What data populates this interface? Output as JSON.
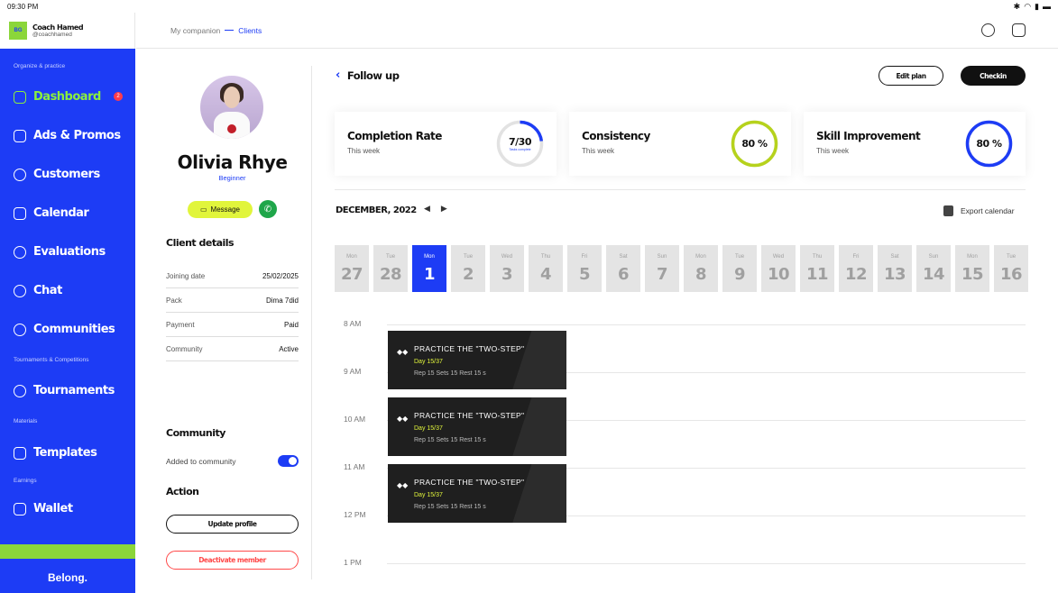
{
  "status": {
    "time": "09:30 PM"
  },
  "brand": {
    "initials": "BG",
    "name": "Coach Hamed",
    "handle": "@coachhamed",
    "footer": "Belong."
  },
  "sidebar": {
    "section_practice": "Organize & practice",
    "section_tournaments": "Tournaments & Competitions",
    "section_materials": "Materials",
    "section_earnings": "Earnings",
    "items": [
      {
        "label": "Dashboard",
        "badge": "2"
      },
      {
        "label": "Ads & Promos"
      },
      {
        "label": "Customers"
      },
      {
        "label": "Calendar"
      },
      {
        "label": "Evaluations"
      },
      {
        "label": "Chat"
      },
      {
        "label": "Communities"
      },
      {
        "label": "Tournaments"
      },
      {
        "label": "Templates"
      },
      {
        "label": "Wallet"
      }
    ]
  },
  "breadcrumb": {
    "parent": "My companion",
    "current": "Clients"
  },
  "profile": {
    "name": "Olivia Rhye",
    "level": "Beginner",
    "message_label": "Message",
    "details_title": "Client details",
    "details": [
      {
        "label": "Joining date",
        "value": "25/02/2025"
      },
      {
        "label": "Pack",
        "value": "Dima 7did"
      },
      {
        "label": "Payment",
        "value": "Paid"
      },
      {
        "label": "Community",
        "value": "Active"
      }
    ],
    "community_title": "Community",
    "community_toggle_label": "Added to community",
    "action_title": "Action",
    "update_label": "Update profile",
    "deactivate_label": "Deactivate member"
  },
  "followup": {
    "title": "Follow up",
    "edit_label": "Edit plan",
    "checkin_label": "Checkin",
    "cards": [
      {
        "title": "Completion Rate",
        "subtitle": "This week",
        "value": "7/30",
        "sub_value": "Tasks complete",
        "progress": 0.23,
        "color": "#1d3cf5"
      },
      {
        "title": "Consistency",
        "subtitle": "This week",
        "value": "80 %",
        "progress": 1.0,
        "color": "#b6d21c"
      },
      {
        "title": "Skill Improvement",
        "subtitle": "This week",
        "value": "80 %",
        "progress": 1.0,
        "color": "#1d3cf5"
      }
    ]
  },
  "calendar": {
    "month": "DECEMBER, 2022",
    "export_label": "Export calendar",
    "days": [
      {
        "name": "Mon",
        "num": "27"
      },
      {
        "name": "Tue",
        "num": "28"
      },
      {
        "name": "Mon",
        "num": "1",
        "selected": true
      },
      {
        "name": "Tue",
        "num": "2"
      },
      {
        "name": "Wed",
        "num": "3"
      },
      {
        "name": "Thu",
        "num": "4"
      },
      {
        "name": "Fri",
        "num": "5"
      },
      {
        "name": "Sat",
        "num": "6"
      },
      {
        "name": "Sun",
        "num": "7"
      },
      {
        "name": "Mon",
        "num": "8"
      },
      {
        "name": "Tue",
        "num": "9"
      },
      {
        "name": "Wed",
        "num": "10"
      },
      {
        "name": "Thu",
        "num": "11"
      },
      {
        "name": "Fri",
        "num": "12"
      },
      {
        "name": "Sat",
        "num": "13"
      },
      {
        "name": "Sun",
        "num": "14"
      },
      {
        "name": "Mon",
        "num": "15"
      },
      {
        "name": "Tue",
        "num": "16"
      }
    ],
    "times": [
      "8 AM",
      "9 AM",
      "10 AM",
      "11 AM",
      "12 PM",
      "1 PM"
    ],
    "events": [
      {
        "title": "PRACTICE THE \"TWO-STEP\"",
        "day": "Day 15/37",
        "meta": "Rep 15   Sets 15   Rest 15 s"
      },
      {
        "title": "PRACTICE THE \"TWO-STEP\"",
        "day": "Day 15/37",
        "meta": "Rep 15   Sets 15   Rest 15 s"
      },
      {
        "title": "PRACTICE THE \"TWO-STEP\"",
        "day": "Day 15/37",
        "meta": "Rep 15   Sets 15   Rest 15 s"
      }
    ]
  }
}
